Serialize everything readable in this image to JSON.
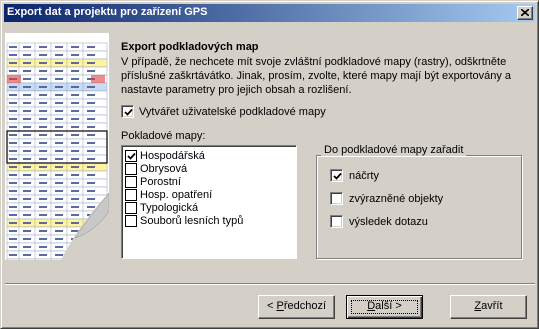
{
  "window": {
    "title": "Export dat a projektu pro zařízení GPS"
  },
  "section": {
    "heading": "Export podkladových map",
    "description": "V případě, že nechcete mít svoje zvláštní podkladové mapy (rastry), odškrtněte příslušné zaškrtávátko. Jinak, prosím, zvolte, které mapy mají být exportovány a nastavte parametry pro jejich obsah a rozlišení."
  },
  "create_maps": {
    "label": "Vytvářet uživatelské podkladové mapy",
    "checked": true
  },
  "maps_list": {
    "label": "Pokladové mapy:",
    "items": [
      {
        "label": "Hospodářská",
        "checked": true
      },
      {
        "label": "Obrysová",
        "checked": false
      },
      {
        "label": "Porostní",
        "checked": false
      },
      {
        "label": "Hosp. opatření",
        "checked": false
      },
      {
        "label": "Typologická",
        "checked": false
      },
      {
        "label": "Souborů lesních typů",
        "checked": false
      }
    ]
  },
  "include_group": {
    "title": "Do podkladové mapy zařadit",
    "items": [
      {
        "label": "náčrty",
        "checked": true
      },
      {
        "label": "zvýrazněné objekty",
        "checked": false
      },
      {
        "label": "výsledek dotazu",
        "checked": false
      }
    ]
  },
  "buttons": {
    "back": {
      "prefix": "< ",
      "mnemonic": "P",
      "rest": "ředchozí"
    },
    "next": {
      "mnemonic": "D",
      "rest": "alší >"
    },
    "close": {
      "mnemonic": "Z",
      "rest": "avřít"
    }
  },
  "colors": {
    "title_start": "#0a246a",
    "title_end": "#a6caf0",
    "face": "#d4d0c8"
  }
}
